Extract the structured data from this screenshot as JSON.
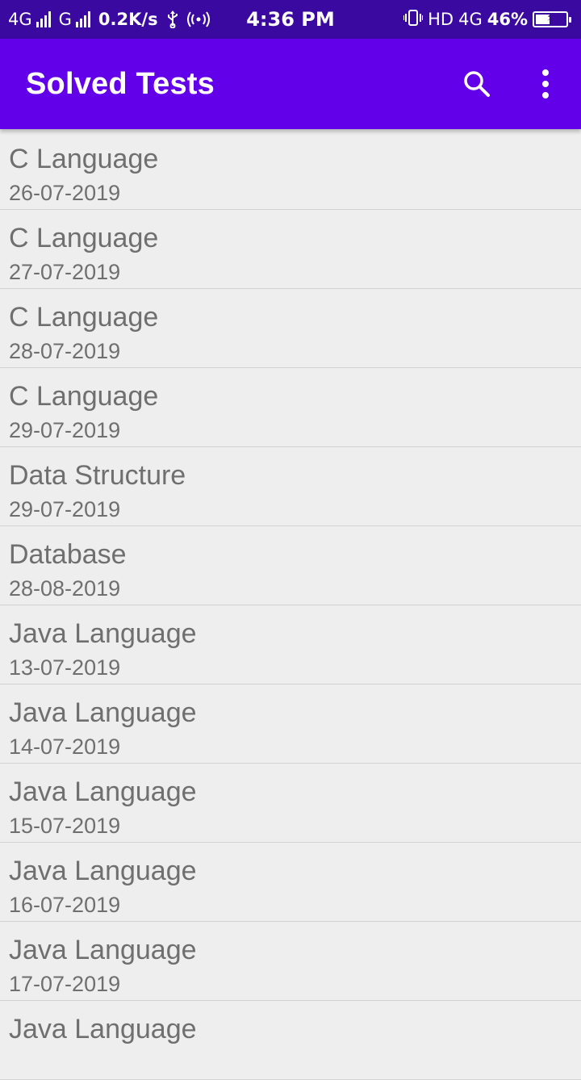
{
  "status_bar": {
    "network_1": "4G",
    "network_2": "G",
    "speed": "0.2K/s",
    "time": "4:36 PM",
    "hd": "HD",
    "network_3": "4G",
    "battery_percent": "46%",
    "battery_level": 0.46,
    "icons": [
      "signal-icon",
      "signal-icon",
      "usb-icon",
      "hotspot-icon",
      "vibrate-icon",
      "battery-charging-icon"
    ]
  },
  "app_bar": {
    "title": "Solved Tests",
    "color": "#6200ea",
    "actions": [
      "search-icon",
      "more-vert-icon"
    ]
  },
  "tests": [
    {
      "subject": "C Language",
      "date": "26-07-2019"
    },
    {
      "subject": "C Language",
      "date": "27-07-2019"
    },
    {
      "subject": "C Language",
      "date": "28-07-2019"
    },
    {
      "subject": "C Language",
      "date": "29-07-2019"
    },
    {
      "subject": "Data Structure",
      "date": "29-07-2019"
    },
    {
      "subject": "Database",
      "date": "28-08-2019"
    },
    {
      "subject": "Java Language",
      "date": "13-07-2019"
    },
    {
      "subject": "Java Language",
      "date": "14-07-2019"
    },
    {
      "subject": "Java Language",
      "date": "15-07-2019"
    },
    {
      "subject": "Java Language",
      "date": "16-07-2019"
    },
    {
      "subject": "Java Language",
      "date": "17-07-2019"
    },
    {
      "subject": "Java Language",
      "date": ""
    }
  ]
}
